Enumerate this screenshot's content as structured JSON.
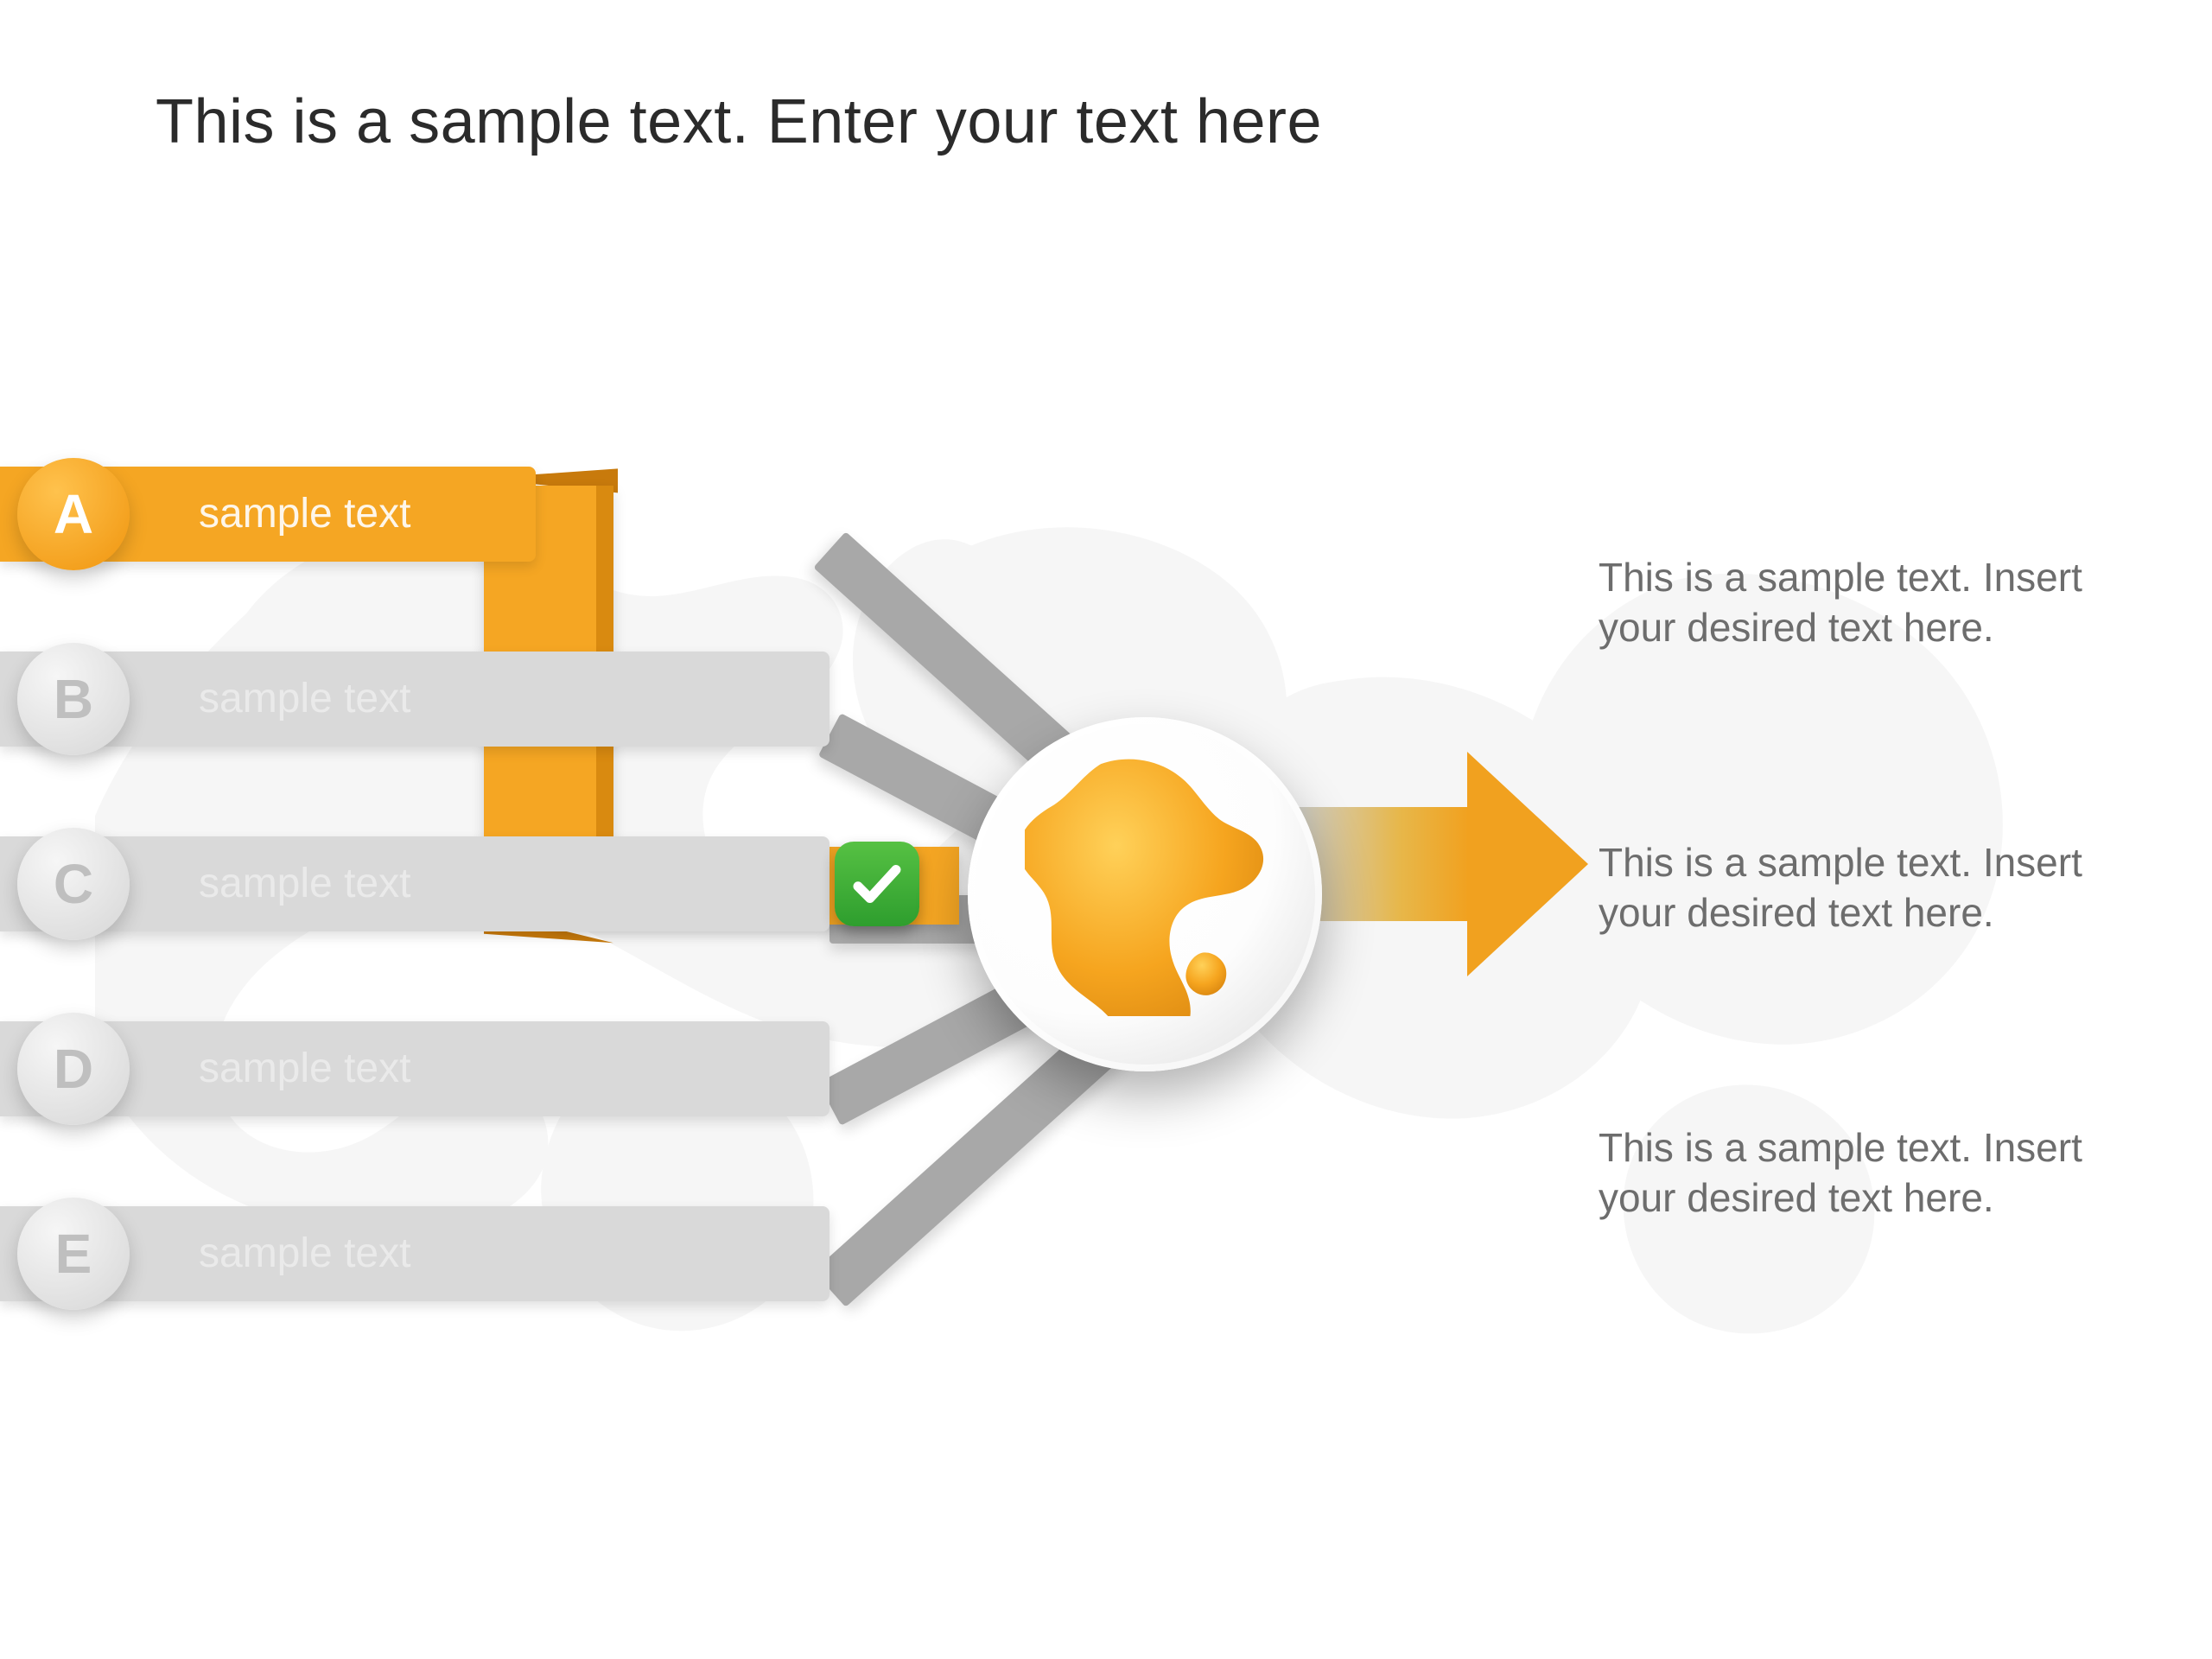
{
  "title": "This is a sample text. Enter your text here",
  "bars": [
    {
      "letter": "A",
      "label": "sample text",
      "active": true
    },
    {
      "letter": "B",
      "label": "sample text",
      "active": false
    },
    {
      "letter": "C",
      "label": "sample text",
      "active": false
    },
    {
      "letter": "D",
      "label": "sample text",
      "active": false
    },
    {
      "letter": "E",
      "label": "sample text",
      "active": false
    }
  ],
  "right_blocks": [
    "This is a sample text. Insert your desired text here.",
    "This is a sample text. Insert your desired text here.",
    "This is a sample text. Insert your desired text here."
  ],
  "colors": {
    "accent": "#f5a623",
    "check_green": "#3fab3b",
    "gray_bar": "#d9d9d9",
    "text_gray": "#6d6d6d"
  },
  "icons": {
    "check": "checkmark-icon",
    "globe": "globe-americas-icon",
    "arrow": "right-arrow-icon"
  }
}
